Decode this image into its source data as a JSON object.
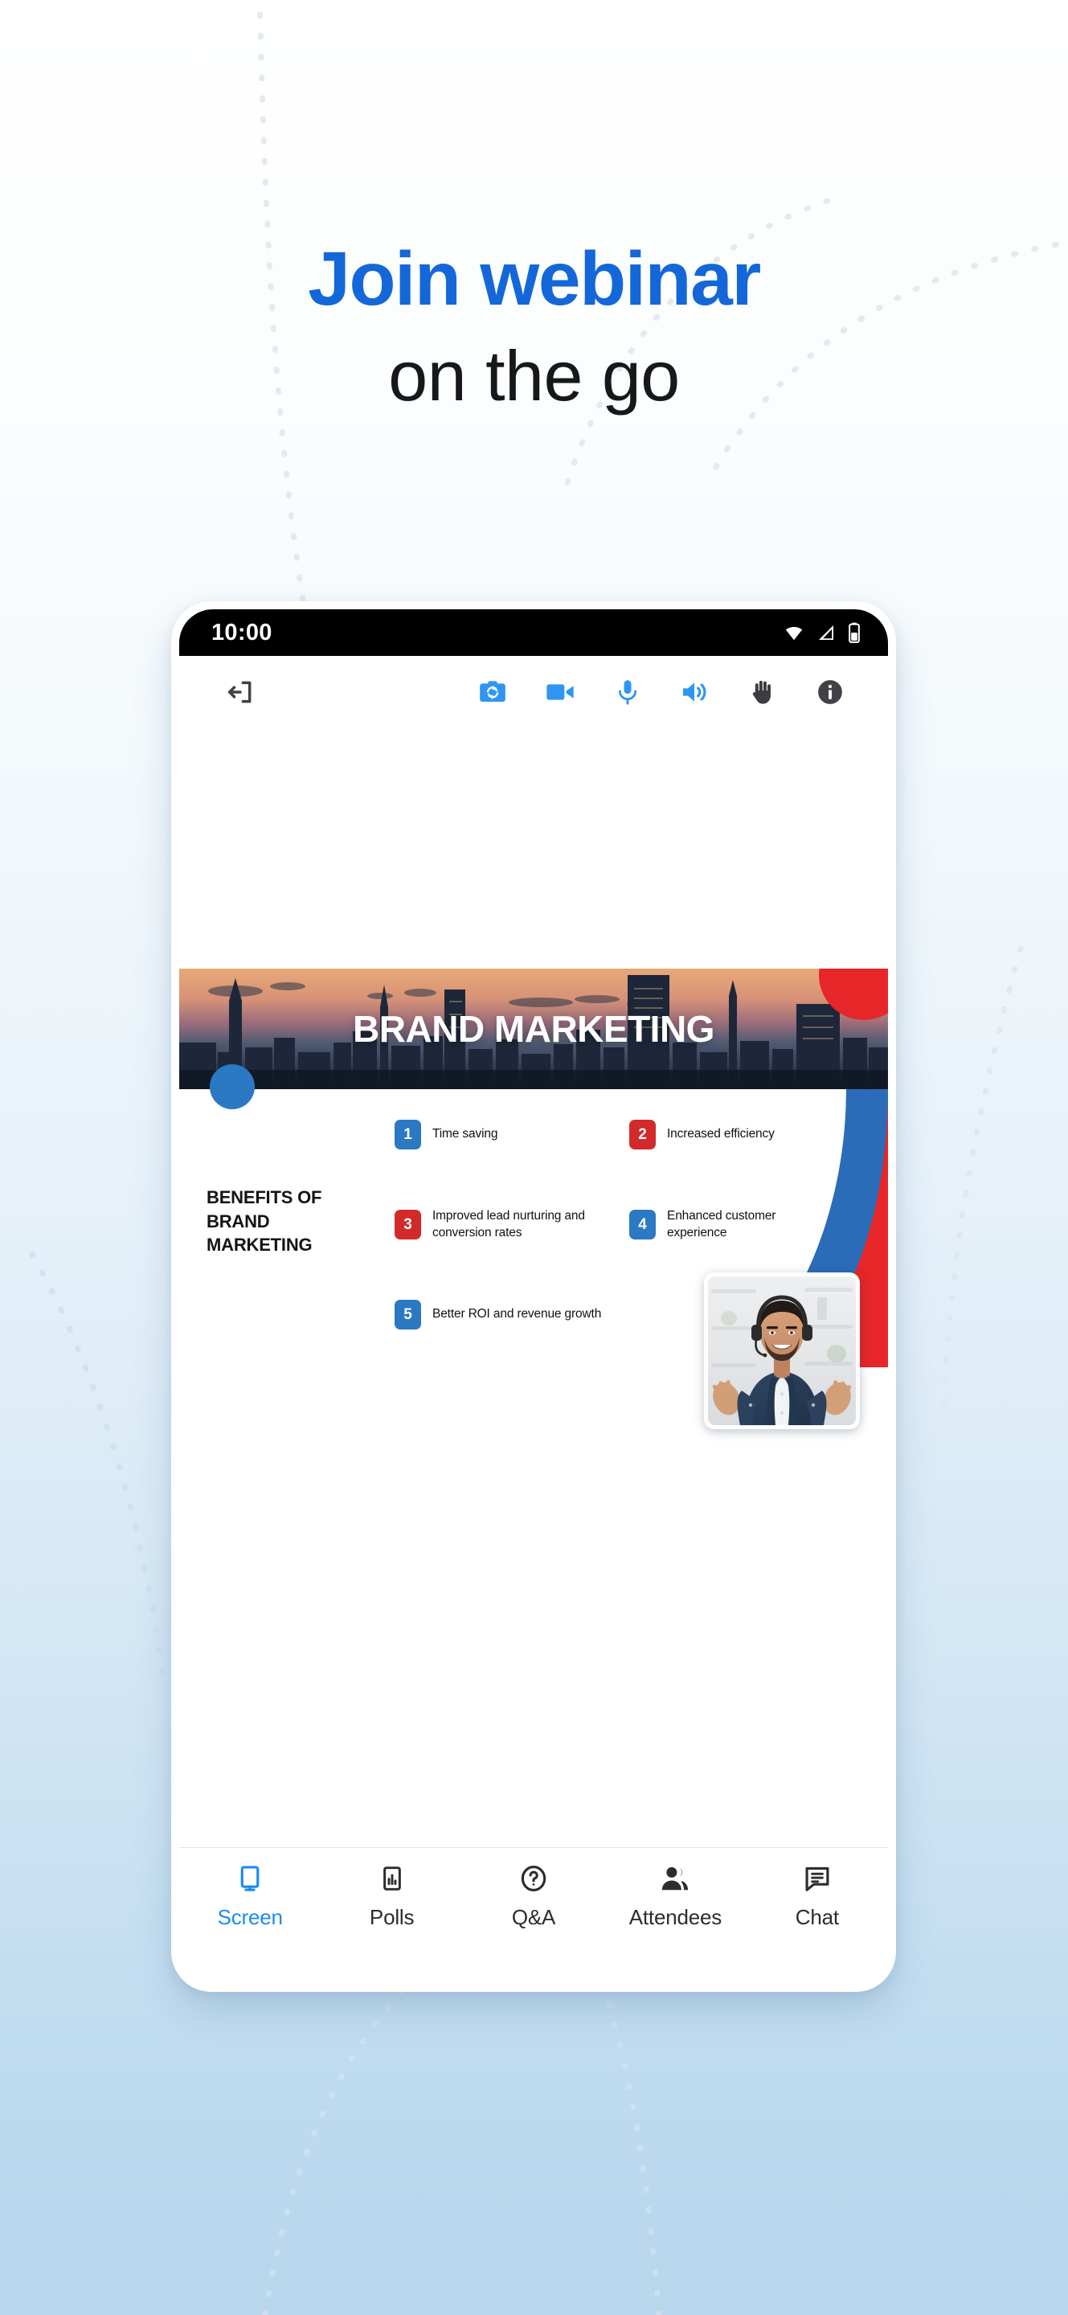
{
  "page": {
    "headline_line1": "Join webinar",
    "headline_line2": "on the go",
    "accent_blue": "#1467d8",
    "background_bottom": "#b8d6ec"
  },
  "phone": {
    "status_bar": {
      "clock": "10:00",
      "icons": [
        "wifi-icon",
        "cellular-signal-icon",
        "battery-icon"
      ]
    },
    "toolbar": {
      "items": [
        {
          "name": "leave-session-button",
          "icon": "exit-icon",
          "color": "#404247",
          "label": "Leave"
        },
        {
          "name": "switch-camera-button",
          "icon": "camera-flip-icon",
          "color": "#2e96f2",
          "label": "Switch camera"
        },
        {
          "name": "video-toggle-button",
          "icon": "video-camera-icon",
          "color": "#2e96f2",
          "label": "Camera"
        },
        {
          "name": "microphone-toggle-button",
          "icon": "microphone-icon",
          "color": "#2e96f2",
          "label": "Microphone"
        },
        {
          "name": "speaker-toggle-button",
          "icon": "speaker-icon",
          "color": "#2e96f2",
          "label": "Speaker"
        },
        {
          "name": "raise-hand-button",
          "icon": "raised-hand-icon",
          "color": "#3b3d42",
          "label": "Raise hand"
        },
        {
          "name": "session-info-button",
          "icon": "info-circle-icon",
          "color": "#404247",
          "label": "Info"
        }
      ]
    },
    "slide": {
      "hero_title": "BRAND MARKETING",
      "section_heading": "BENEFITS OF BRAND MARKETING",
      "accent_blue": "#2b79c2",
      "accent_red": "#d22a2a",
      "benefits": [
        {
          "number": "1",
          "color": "blue",
          "text": "Time saving"
        },
        {
          "number": "2",
          "color": "red",
          "text": "Increased efficiency"
        },
        {
          "number": "3",
          "color": "red",
          "text": "Improved lead nurturing and conversion rates"
        },
        {
          "number": "4",
          "color": "blue",
          "text": "Enhanced customer experience"
        },
        {
          "number": "5",
          "color": "blue",
          "text": "Better ROI and revenue growth"
        }
      ]
    },
    "presenter": {
      "name": "presenter-video-thumbnail",
      "description": "Smiling man wearing a headset with open hands"
    },
    "bottom_nav": {
      "active": "Screen",
      "items": [
        {
          "label": "Screen",
          "icon": "monitor-icon"
        },
        {
          "label": "Polls",
          "icon": "bar-chart-icon"
        },
        {
          "label": "Q&A",
          "icon": "question-circle-icon"
        },
        {
          "label": "Attendees",
          "icon": "people-icon"
        },
        {
          "label": "Chat",
          "icon": "chat-bubble-icon"
        }
      ]
    }
  }
}
